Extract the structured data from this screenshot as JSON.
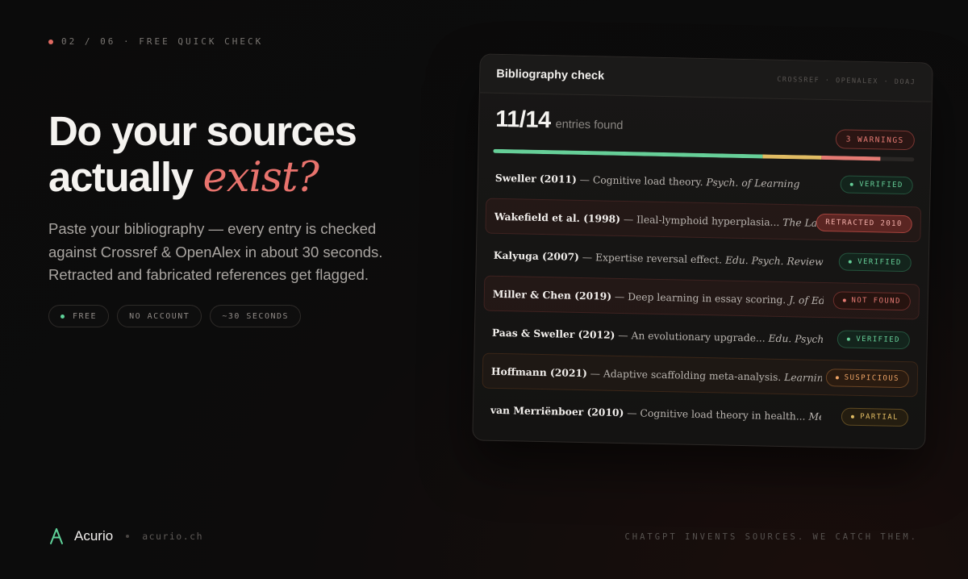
{
  "step": {
    "text": "02 / 06 · FREE QUICK CHECK"
  },
  "hero": {
    "title_line1": "Do your sources",
    "title_word2": "actually",
    "title_accent": "exist?",
    "description": "Paste your bibliography — every entry is checked against Crossref & OpenAlex in about 30 seconds. Retracted and fabricated references get flagged."
  },
  "pills": [
    {
      "label": "FREE",
      "icon": "green-dot-icon"
    },
    {
      "label": "NO ACCOUNT"
    },
    {
      "label": "~30 SECONDS"
    }
  ],
  "card": {
    "title": "Bibliography check",
    "sources": "CROSSREF · OPENALEX · DOAJ",
    "count": "11/14",
    "count_label": "entries found",
    "warnings": "3 WARNINGS",
    "progress": {
      "found": 11,
      "total": 14,
      "verified_fraction": 0.64,
      "partial_fraction": 0.14,
      "flagged_fraction": 0.14
    },
    "rows": [
      {
        "author": "Sweller (2011)",
        "title": " — Cognitive load theory. ",
        "journal": "Psych. of Learning",
        "status": "VERIFIED",
        "kind": "verified"
      },
      {
        "author": "Wakefield et al. (1998)",
        "title": " — Ileal-lymphoid hyperplasia... ",
        "journal": "The Lancet",
        "status": "RETRACTED 2010",
        "kind": "retracted"
      },
      {
        "author": "Kalyuga (2007)",
        "title": " — Expertise reversal effect. ",
        "journal": "Edu. Psych. Review",
        "status": "VERIFIED",
        "kind": "verified"
      },
      {
        "author": "Miller & Chen (2019)",
        "title": " — Deep learning in essay scoring. ",
        "journal": "J. of EdTech AI",
        "status": "NOT FOUND",
        "kind": "notfound"
      },
      {
        "author": "Paas & Sweller (2012)",
        "title": " — An evolutionary upgrade... ",
        "journal": "Edu. Psych. Review",
        "status": "VERIFIED",
        "kind": "verified"
      },
      {
        "author": "Hoffmann (2021)",
        "title": " — Adaptive scaffolding meta-analysis. ",
        "journal": "Learning & Ins...",
        "status": "SUSPICIOUS",
        "kind": "sus"
      },
      {
        "author": "van Merriënboer (2010)",
        "title": " — Cognitive load theory in health... ",
        "journal": "Med. Educ.",
        "status": "PARTIAL",
        "kind": "partial"
      }
    ]
  },
  "footer": {
    "brand": "Acurio",
    "url": "acurio.ch",
    "tagline": "CHATGPT INVENTS SOURCES. WE CATCH THEM."
  },
  "colors": {
    "accent": "#e8736d",
    "verified": "#66cf98",
    "partial": "#e1bc63",
    "flagged": "#e57a73"
  }
}
